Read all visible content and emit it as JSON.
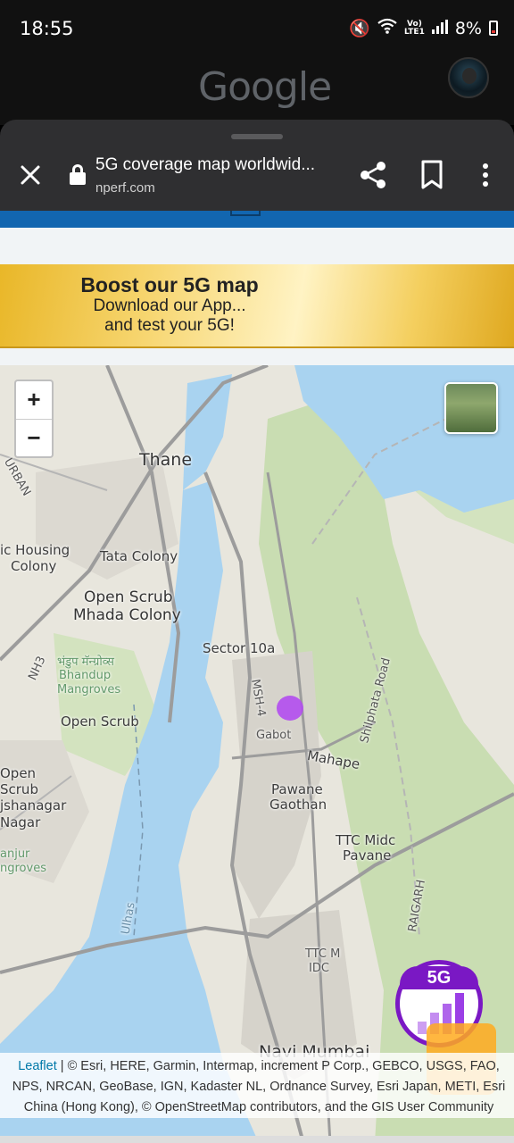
{
  "status_bar": {
    "time": "18:55",
    "battery": "8%",
    "network": "Vo) LTE1"
  },
  "browser": {
    "brand": "Google",
    "tab_title": "5G coverage map worldwid...",
    "tab_domain": "nperf.com",
    "close_icon": "close-icon",
    "share_icon": "share-icon",
    "bookmark_icon": "bookmark-icon",
    "menu_icon": "more-vert-icon"
  },
  "banner": {
    "title": "Boost our 5G map",
    "line1": "Download our App...",
    "line2": "and test your 5G!"
  },
  "map": {
    "zoom_in": "+",
    "zoom_out": "−",
    "labels": {
      "thane": "Thane",
      "tata_colony": "Tata Colony",
      "open_scrub_1": "Open Scrub",
      "mhada_colony": "Mhada Colony",
      "sector_10a": "Sector 10a",
      "bhandup_native": "भंडुप मॅन्ग्रोव्स",
      "bhandup": "Bhandup",
      "mangroves": "Mangroves",
      "open_scrub_2": "Open Scrub",
      "gabot": "Gabot",
      "mahape": "Mahape",
      "shilphata_road": "Shilphata Road",
      "pawane": "Pawane",
      "gaothan": "Gaothan",
      "ttc_midc": "TTC Midc",
      "pavane": "Pavane",
      "raigarh": "RAIGARH",
      "ulhas": "Ulhas",
      "ttc_m": "TTC M",
      "idc": "IDC",
      "navi_mumbai": "Navi Mumbai",
      "msh4": "MSH-4",
      "nh3": "NH3",
      "urban": "URBAN",
      "housing": "ic Housing",
      "colony": "Colony",
      "open": "Open",
      "scrub": "Scrub",
      "jshanagar": "jshanagar",
      "nagar": "Nagar",
      "anjur": "anjur",
      "ngroves": "ngroves"
    },
    "badge_label": "5G",
    "attribution_link": "Leaflet",
    "attribution_text": " | © Esri, HERE, Garmin, Intermap, increment P Corp., GEBCO, USGS, FAO, NPS, NRCAN, GeoBase, IGN, Kadaster NL, Ordnance Survey, Esri Japan, METI, Esri China (Hong Kong), © OpenStreetMap contributors, and the GIS User Community",
    "colors": {
      "water": "#a9d3f0",
      "land": "#e8e6dd",
      "green": "#c9ddb2",
      "coverage": "#b34cf0",
      "badge": "#7a18c4"
    }
  }
}
